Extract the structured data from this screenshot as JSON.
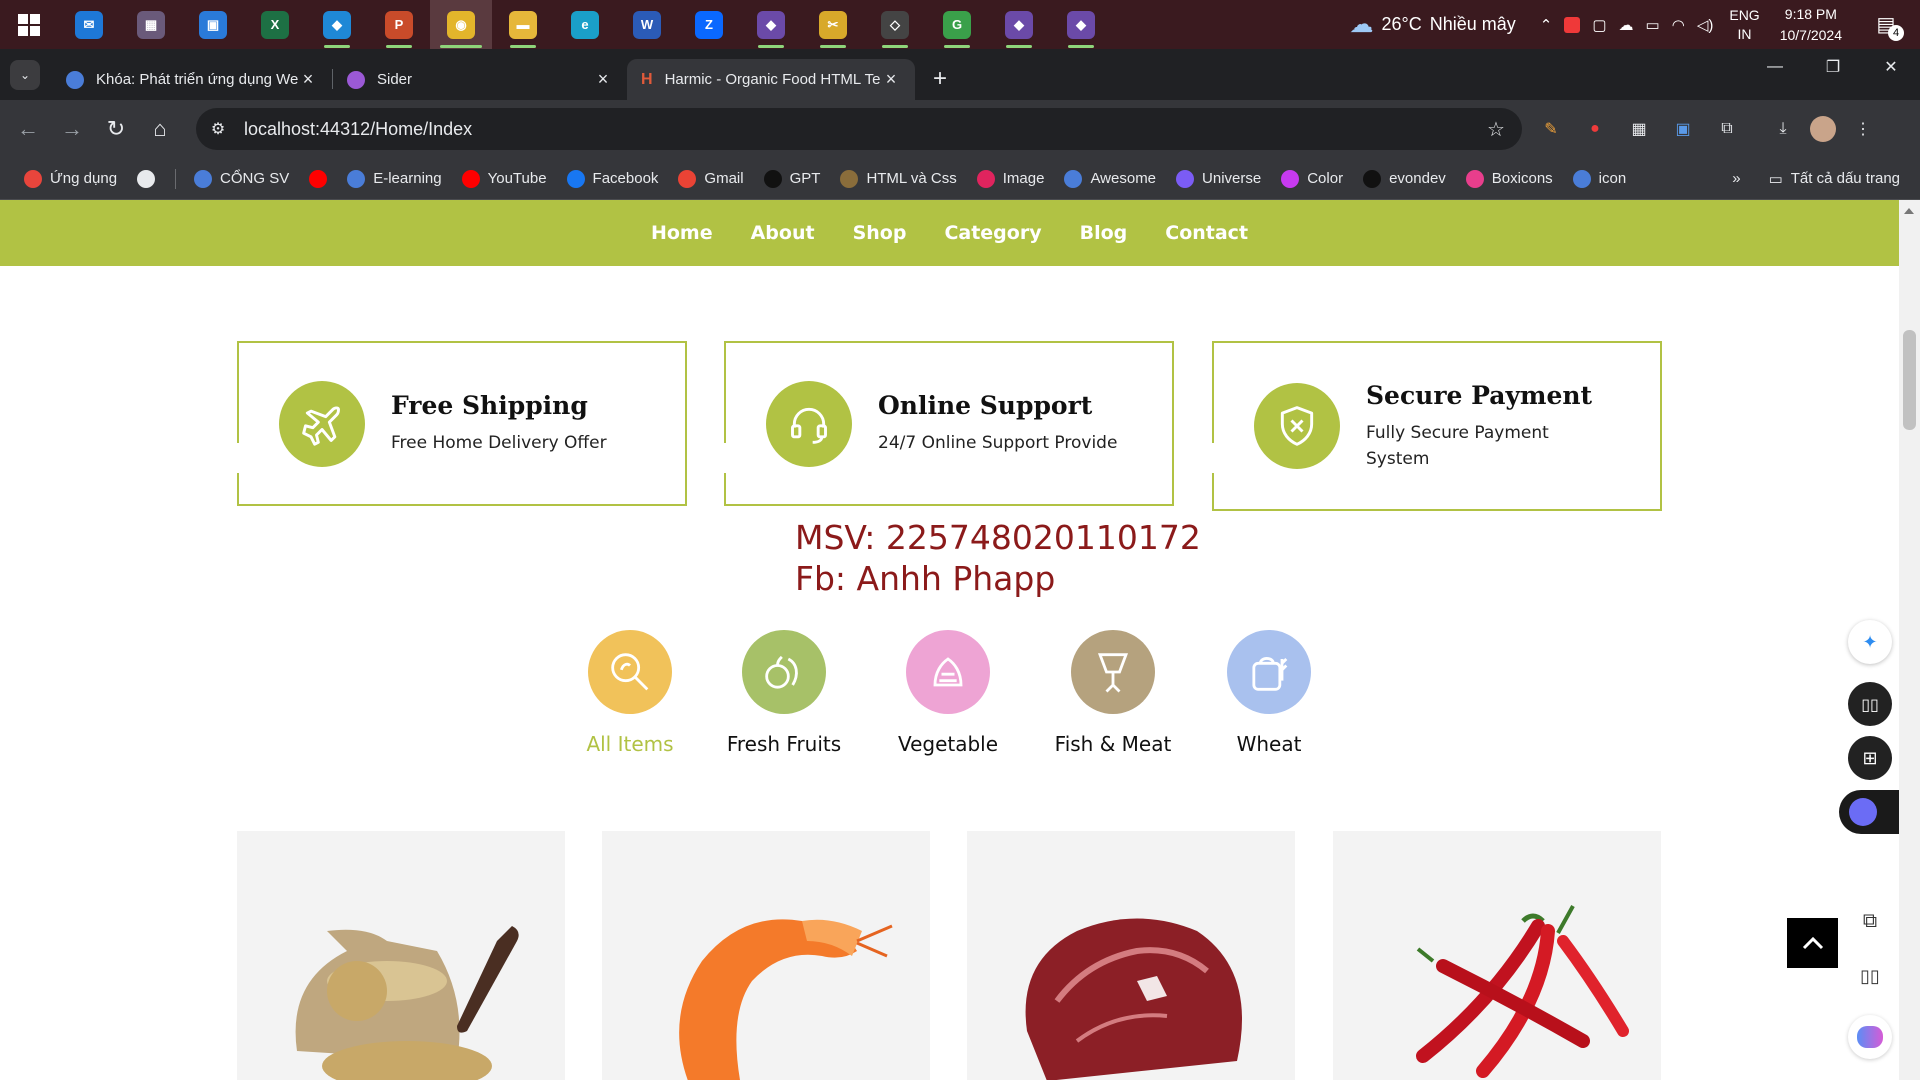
{
  "taskbar": {
    "apps": [
      {
        "name": "mail-app",
        "color": "#1e78d7",
        "glyph": "✉"
      },
      {
        "name": "remote-app",
        "color": "#6a5a7a",
        "glyph": "▦"
      },
      {
        "name": "store-app",
        "color": "#2a7ad9",
        "glyph": "▣"
      },
      {
        "name": "excel-app",
        "color": "#1d7044",
        "glyph": "X"
      },
      {
        "name": "vscode-app",
        "color": "#1f88d6",
        "glyph": "◆"
      },
      {
        "name": "powerpoint-app",
        "color": "#c94b2a",
        "glyph": "P"
      },
      {
        "name": "chrome-app",
        "color": "#e3b52b",
        "glyph": "◉"
      },
      {
        "name": "explorer-app",
        "color": "#e6b73a",
        "glyph": "▬"
      },
      {
        "name": "edge-app",
        "color": "#1a9fc9",
        "glyph": "e"
      },
      {
        "name": "word-app",
        "color": "#2b5bb7",
        "glyph": "W"
      },
      {
        "name": "zalo-app",
        "color": "#0a68ff",
        "glyph": "Z"
      },
      {
        "name": "visualstudio-app",
        "color": "#6b4aa8",
        "glyph": "◆"
      },
      {
        "name": "snipping-app",
        "color": "#d8a92a",
        "glyph": "✂"
      },
      {
        "name": "git-app",
        "color": "#444444",
        "glyph": "◇"
      },
      {
        "name": "greenapp-app",
        "color": "#3aa04a",
        "glyph": "G"
      },
      {
        "name": "vspreview-app",
        "color": "#6b4aa8",
        "glyph": "◆"
      },
      {
        "name": "vspreview2-app",
        "color": "#6b4aa8",
        "glyph": "◆"
      }
    ],
    "weather": {
      "temp": "26°C",
      "desc": "Nhiều mây"
    },
    "lang": {
      "line1": "ENG",
      "line2": "IN"
    },
    "clock": {
      "time": "9:18 PM",
      "date": "10/7/2024"
    },
    "notifications": "4"
  },
  "tabs": [
    {
      "title": "Khóa: Phát triển ứng dụng Web",
      "active": false,
      "favicon_color": "#4a7dd8"
    },
    {
      "title": "Sider",
      "active": false,
      "favicon_color": "#9b59d6"
    },
    {
      "title": "Harmic - Organic Food HTML Te",
      "active": true,
      "favicon_color": "#e05a3a"
    }
  ],
  "toolbar": {
    "url": "localhost:44312/Home/Index"
  },
  "bookmarks": {
    "items": [
      {
        "label": "Ứng dụng",
        "color": "#e8453c"
      },
      {
        "label": "",
        "color": "#e8eaed"
      },
      {
        "label": "CỔNG SV",
        "color": "#4a7dd8"
      },
      {
        "label": "",
        "color": "#ff0000"
      },
      {
        "label": "E-learning",
        "color": "#4a7dd8"
      },
      {
        "label": "YouTube",
        "color": "#ff0000"
      },
      {
        "label": "Facebook",
        "color": "#1877f2"
      },
      {
        "label": "Gmail",
        "color": "#ea4335"
      },
      {
        "label": "GPT",
        "color": "#111111"
      },
      {
        "label": "HTML và Css",
        "color": "#8a6d3b"
      },
      {
        "label": "Image",
        "color": "#e0245e"
      },
      {
        "label": "Awesome",
        "color": "#4a7dd8"
      },
      {
        "label": "Universe",
        "color": "#7b5cf5"
      },
      {
        "label": "Color",
        "color": "#c73af0"
      },
      {
        "label": "evondev",
        "color": "#111111"
      },
      {
        "label": "Boxicons",
        "color": "#e83e8c"
      },
      {
        "label": "icon",
        "color": "#4a7dd8"
      }
    ],
    "all_bookmarks": "Tất cả dấu trang"
  },
  "site": {
    "nav": [
      "Home",
      "About",
      "Shop",
      "Category",
      "Blog",
      "Contact"
    ],
    "features": [
      {
        "title": "Free Shipping",
        "desc": "Free Home Delivery Offer",
        "icon": "plane-icon"
      },
      {
        "title": "Online Support",
        "desc": "24/7 Online Support Provide",
        "icon": "headset-icon"
      },
      {
        "title": "Secure Payment",
        "desc": "Fully Secure Payment System",
        "icon": "shield-icon"
      }
    ],
    "student": {
      "msv": "MSV: 225748020110172",
      "fb": "Fb: Anhh Phapp"
    },
    "categories": [
      {
        "label": "All Items",
        "color": "#f1c25a",
        "active": true
      },
      {
        "label": "Fresh Fruits",
        "color": "#a7c168",
        "active": false
      },
      {
        "label": "Vegetable",
        "color": "#eea4d4",
        "active": false
      },
      {
        "label": "Fish & Meat",
        "color": "#b5a27e",
        "active": false
      },
      {
        "label": "Wheat",
        "color": "#a9c1ee",
        "active": false
      }
    ],
    "products": [
      "grain-sack",
      "shrimp",
      "beef-steak",
      "red-chili"
    ],
    "accent": "#b1c244",
    "student_color": "#8b1a1a"
  }
}
